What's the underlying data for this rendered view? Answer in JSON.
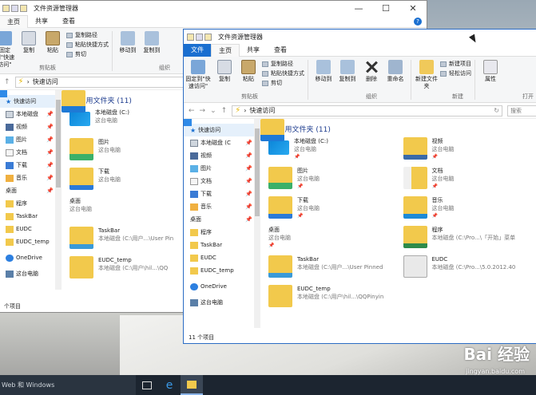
{
  "back_window": {
    "title": "文件资源管理器",
    "tabs": [
      "主页",
      "共享",
      "查看"
    ],
    "ribbon": {
      "pin_label": "固定到\"快速访问\"",
      "copy": "复制",
      "paste": "粘贴",
      "copy_path": "复制路径",
      "paste_shortcut": "粘贴快捷方式",
      "cut": "剪切",
      "clipboard_group": "剪贴板",
      "move_to": "移动到",
      "copy_to": "复制到",
      "organize_group": "组织"
    },
    "address": "快速访问",
    "nav": [
      {
        "label": "快速访问",
        "icon": "star-icon"
      },
      {
        "label": "本地磁盘",
        "icon": "drive-icon"
      },
      {
        "label": "视频",
        "icon": "video-icon"
      },
      {
        "label": "图片",
        "icon": "picture-icon"
      },
      {
        "label": "文档",
        "icon": "document-icon"
      },
      {
        "label": "下载",
        "icon": "download-icon"
      },
      {
        "label": "音乐",
        "icon": "music-icon"
      },
      {
        "label": "桌面",
        "icon": "desktop-icon"
      },
      {
        "label": "程序",
        "icon": "folder-icon"
      },
      {
        "label": "TaskBar",
        "icon": "folder-icon"
      },
      {
        "label": "EUDC",
        "icon": "folder-icon"
      },
      {
        "label": "EUDC_temp",
        "icon": "folder-icon"
      },
      {
        "label": "OneDrive",
        "icon": "cloud-icon"
      },
      {
        "label": "这台电脑",
        "icon": "computer-icon"
      }
    ],
    "section": "常用文件夹 (11)",
    "items": [
      {
        "name": "本地磁盘 (C:)",
        "sub": "这台电脑"
      },
      {
        "name": "图片",
        "sub": "这台电脑"
      },
      {
        "name": "下载",
        "sub": "这台电脑"
      },
      {
        "name": "桌面",
        "sub": "这台电脑"
      },
      {
        "name": "TaskBar",
        "sub": "本地磁盘 (C:\\用户...\\User Pin"
      },
      {
        "name": "EUDC_temp",
        "sub": "本地磁盘 (C:\\用户\\hil...\\QQ"
      }
    ],
    "status": "个项目"
  },
  "front_window": {
    "title": "文件资源管理器",
    "tabs": [
      "文件",
      "主页",
      "共享",
      "查看"
    ],
    "ribbon": {
      "pin_label": "固定到\"快速访问\"",
      "copy": "复制",
      "paste": "粘贴",
      "copy_path": "复制路径",
      "paste_shortcut": "粘贴快捷方式",
      "cut": "剪切",
      "clipboard_group": "剪贴板",
      "move_to": "移动到",
      "copy_to": "复制到",
      "delete": "删除",
      "rename": "重命名",
      "organize_group": "组织",
      "new_folder": "新建文件夹",
      "new_item": "新建项目",
      "easy_access": "轻松访问",
      "new_group": "新建",
      "properties": "属性",
      "open_group": "打开"
    },
    "address": "快速访问",
    "search_placeholder": "搜索",
    "nav": [
      {
        "label": "快速访问"
      },
      {
        "label": "本地磁盘 (C"
      },
      {
        "label": "视频"
      },
      {
        "label": "图片"
      },
      {
        "label": "文档"
      },
      {
        "label": "下载"
      },
      {
        "label": "音乐"
      },
      {
        "label": "桌面"
      },
      {
        "label": "程序"
      },
      {
        "label": "TaskBar"
      },
      {
        "label": "EUDC"
      },
      {
        "label": "EUDC_temp"
      },
      {
        "label": "OneDrive"
      },
      {
        "label": "这台电脑"
      }
    ],
    "section": "常用文件夹 (11)",
    "items": [
      {
        "name": "本地磁盘 (C:)",
        "sub": "这台电脑",
        "icon": "drive"
      },
      {
        "name": "视频",
        "sub": "这台电脑",
        "icon": "video"
      },
      {
        "name": "图片",
        "sub": "这台电脑",
        "icon": "pic"
      },
      {
        "name": "文档",
        "sub": "这台电脑",
        "icon": "doc"
      },
      {
        "name": "下载",
        "sub": "这台电脑",
        "icon": "dl"
      },
      {
        "name": "音乐",
        "sub": "这台电脑",
        "icon": "music"
      },
      {
        "name": "桌面",
        "sub": "这台电脑",
        "icon": "desk"
      },
      {
        "name": "程序",
        "sub": "本地磁盘 (C:\\Pro...\\「开始」菜单",
        "icon": "prog"
      },
      {
        "name": "TaskBar",
        "sub": "本地磁盘 (C:\\用户...\\User Pinned",
        "icon": "tb"
      },
      {
        "name": "EUDC",
        "sub": "本地磁盘 (C:\\Pro...\\5.0.2012.40",
        "icon": "eudc"
      },
      {
        "name": "EUDC_temp",
        "sub": "本地磁盘 (C:\\用户\\hil...\\QQPinyin",
        "icon": "plain"
      }
    ],
    "status": "11 个项目"
  },
  "taskbar": {
    "search_text": "Web 和 Windows"
  },
  "watermark": {
    "logo": "Bai 经验",
    "url": "jingyan.baidu.com"
  }
}
